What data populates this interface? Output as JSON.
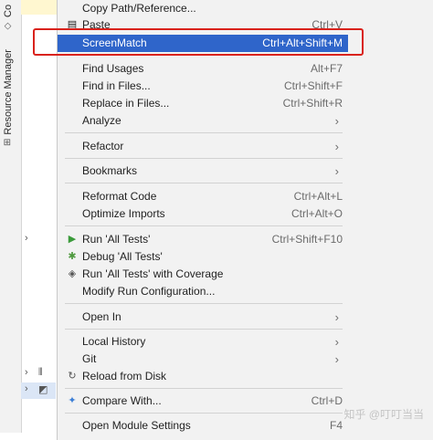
{
  "side_panel": {
    "top_tab": "Co",
    "resource_tab": "Resource Manager"
  },
  "context_menu": {
    "items": [
      {
        "label": "Copy Path/Reference...",
        "shortcut": ""
      },
      {
        "label": "Paste",
        "shortcut": "Ctrl+V"
      },
      {
        "label": "ScreenMatch",
        "shortcut": "Ctrl+Alt+Shift+M"
      },
      {
        "label": "Find Usages",
        "shortcut": "Alt+F7"
      },
      {
        "label": "Find in Files...",
        "shortcut": "Ctrl+Shift+F"
      },
      {
        "label": "Replace in Files...",
        "shortcut": "Ctrl+Shift+R"
      },
      {
        "label": "Analyze",
        "shortcut": ""
      },
      {
        "label": "Refactor",
        "shortcut": ""
      },
      {
        "label": "Bookmarks",
        "shortcut": ""
      },
      {
        "label": "Reformat Code",
        "shortcut": "Ctrl+Alt+L"
      },
      {
        "label": "Optimize Imports",
        "shortcut": "Ctrl+Alt+O"
      },
      {
        "label": "Run 'All Tests'",
        "shortcut": "Ctrl+Shift+F10"
      },
      {
        "label": "Debug 'All Tests'",
        "shortcut": ""
      },
      {
        "label": "Run 'All Tests' with Coverage",
        "shortcut": ""
      },
      {
        "label": "Modify Run Configuration...",
        "shortcut": ""
      },
      {
        "label": "Open In",
        "shortcut": ""
      },
      {
        "label": "Local History",
        "shortcut": ""
      },
      {
        "label": "Git",
        "shortcut": ""
      },
      {
        "label": "Reload from Disk",
        "shortcut": ""
      },
      {
        "label": "Compare With...",
        "shortcut": "Ctrl+D"
      },
      {
        "label": "Open Module Settings",
        "shortcut": "F4"
      }
    ]
  },
  "watermark": "知乎 @叮叮当当",
  "colors": {
    "highlight": "#2f65ca",
    "annotation_box": "#d9221c",
    "run_icon": "#3b9b3b",
    "compare_icon": "#3d7fd6"
  },
  "icons": {
    "run": "play-icon",
    "debug": "bug-icon",
    "coverage": "shield-play-icon",
    "reload": "refresh-icon",
    "compare": "sparkle-arrows-icon",
    "paste": "clipboard-icon",
    "submenu": "chevron-right-icon"
  }
}
